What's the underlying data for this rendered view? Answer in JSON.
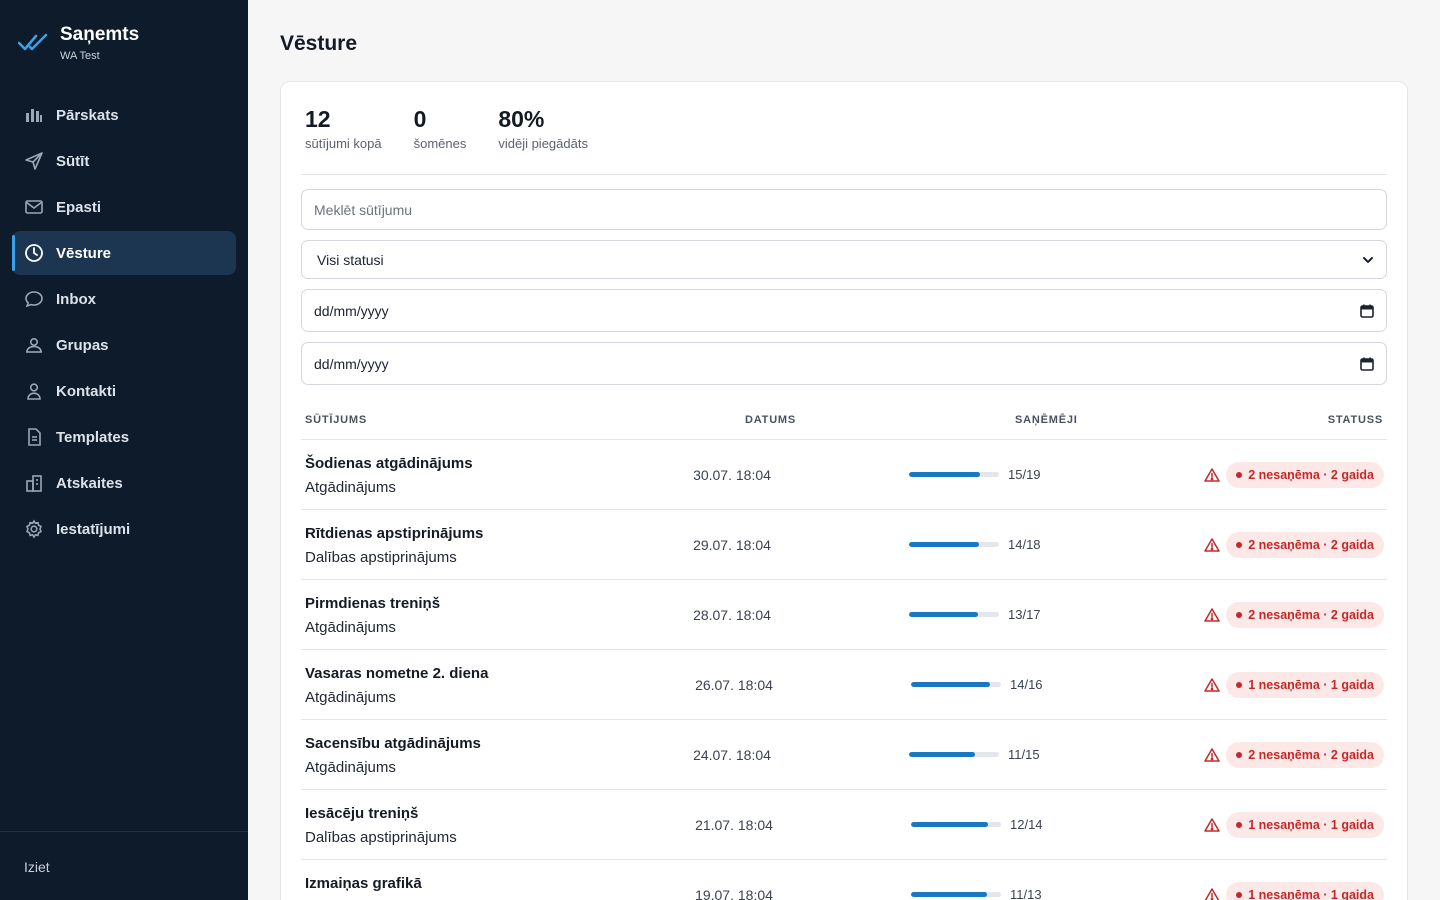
{
  "brand": {
    "name": "Saņemts",
    "subtitle": "WA Test",
    "accent": "#3aa0e8"
  },
  "nav": [
    {
      "label": "Pārskats",
      "icon": "bar-chart-icon",
      "active": false
    },
    {
      "label": "Sūtīt",
      "icon": "send-icon",
      "active": false
    },
    {
      "label": "Epasti",
      "icon": "mail-icon",
      "active": false
    },
    {
      "label": "Vēsture",
      "icon": "clock-icon",
      "active": true
    },
    {
      "label": "Inbox",
      "icon": "chat-bubble-icon",
      "active": false
    },
    {
      "label": "Grupas",
      "icon": "group-icon",
      "active": false
    },
    {
      "label": "Kontakti",
      "icon": "user-icon",
      "active": false
    },
    {
      "label": "Templates",
      "icon": "document-icon",
      "active": false
    },
    {
      "label": "Atskaites",
      "icon": "buildings-icon",
      "active": false
    },
    {
      "label": "Iestatījumi",
      "icon": "gear-icon",
      "active": false
    }
  ],
  "logout_label": "Iziet",
  "page_title": "Vēsture",
  "stats": [
    {
      "value": "12",
      "label": "sūtījumi kopā"
    },
    {
      "value": "0",
      "label": "šomēnes"
    },
    {
      "value": "80%",
      "label": "vidēji piegādāts"
    }
  ],
  "filters": {
    "search_placeholder": "Meklēt sūtījumu",
    "status_selected": "Visi statusi",
    "date_from": "dd/mm/yyyy",
    "date_to": "dd/mm/yyyy"
  },
  "table": {
    "headers": {
      "name": "SŪTĪJUMS",
      "date": "DATUMS",
      "recipients": "SAŅĒMĒJI",
      "status": "STATUSS"
    },
    "rows": [
      {
        "title": "Šodienas atgādinājums",
        "type": "Atgādinājums",
        "date": "30.07. 18:04",
        "received": 15,
        "total": 19,
        "ratio": "15/19",
        "status": "2 nesaņēma · 2 gaida"
      },
      {
        "title": "Rītdienas apstiprinājums",
        "type": "Dalības apstiprinājums",
        "date": "29.07. 18:04",
        "received": 14,
        "total": 18,
        "ratio": "14/18",
        "status": "2 nesaņēma · 2 gaida"
      },
      {
        "title": "Pirmdienas treniņš",
        "type": "Atgādinājums",
        "date": "28.07. 18:04",
        "received": 13,
        "total": 17,
        "ratio": "13/17",
        "status": "2 nesaņēma · 2 gaida"
      },
      {
        "title": "Vasaras nometne 2. diena",
        "type": "Atgādinājums",
        "date": "26.07. 18:04",
        "received": 14,
        "total": 16,
        "ratio": "14/16",
        "status": "1 nesaņēma · 1 gaida"
      },
      {
        "title": "Sacensību atgādinājums",
        "type": "Atgādinājums",
        "date": "24.07. 18:04",
        "received": 11,
        "total": 15,
        "ratio": "11/15",
        "status": "2 nesaņēma · 2 gaida"
      },
      {
        "title": "Iesācēju treniņš",
        "type": "Dalības apstiprinājums",
        "date": "21.07. 18:04",
        "received": 12,
        "total": 14,
        "ratio": "12/14",
        "status": "1 nesaņēma · 1 gaida"
      },
      {
        "title": "Izmaiņas grafikā",
        "type": "",
        "date": "19.07. 18:04",
        "received": 11,
        "total": 13,
        "ratio": "11/13",
        "status": "1 nesaņēma · 1 gaida"
      }
    ]
  },
  "colors": {
    "sidebar": "#0e1b2a",
    "progress": "#1878c4",
    "badge_bg": "#fde8e8",
    "badge_text": "#c62828"
  }
}
